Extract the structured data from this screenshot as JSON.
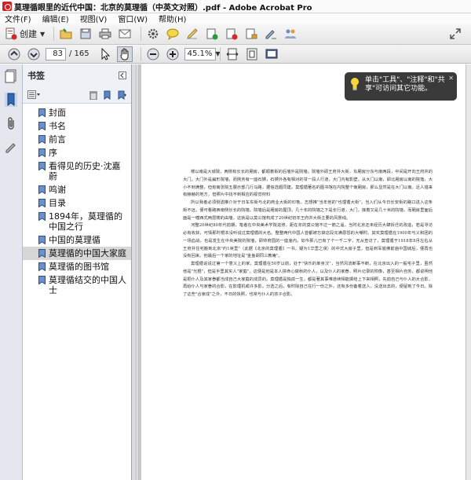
{
  "window": {
    "title": "莫理循眼里的近代中国：北京的莫理循（中英文对照）.pdf - Adobe Acrobat Pro"
  },
  "menu": [
    "文件(F)",
    "编辑(E)",
    "视图(V)",
    "窗口(W)",
    "帮助(H)"
  ],
  "toolbar": {
    "create_label": "创建"
  },
  "nav": {
    "page_current": "83",
    "page_total": "/ 165",
    "zoom": "45.1%",
    "tabs": [
      "工具",
      "注释",
      "共享"
    ]
  },
  "bookmarks": {
    "header": "书签",
    "items": [
      {
        "label": "封面",
        "selected": false
      },
      {
        "label": "书名",
        "selected": false
      },
      {
        "label": "前言",
        "selected": false
      },
      {
        "label": "序",
        "selected": false
      },
      {
        "label": "看得见的历史·沈嘉蔚",
        "selected": false
      },
      {
        "label": "鸣谢",
        "selected": false
      },
      {
        "label": "目录",
        "selected": false
      },
      {
        "label": "1894年，莫理循的中国之行",
        "selected": false
      },
      {
        "label": "中国的莫理循",
        "selected": false
      },
      {
        "label": "莫理循的中国大家庭",
        "selected": true
      },
      {
        "label": "莫理循的图书馆",
        "selected": false
      },
      {
        "label": "莫理循结交的中国人士",
        "selected": false
      }
    ]
  },
  "tooltip": {
    "text": "单击\"工具\"、\"注释\"和\"共享\"可访问其它功能。"
  },
  "document": {
    "paragraphs": [
      "楼以南是大城院，两侧有长长的厢房，都顺着街的后墙外是院墙。院墙外即王府井大街，东厢房分东与南两段，中间是开向王府井的大门。大门外是扁形院墙，而侧务有一座石狮，石狮外各有相对的甘一段人行道，大门内有影壁，从大门以南，即北厢房以南的院落，大小不到满整，但有南张院五展示部几行马路，据信选题同建。莫理循著名的图书馆在内院整个南厢房，那么显然是在大门以南。近人措来有赫赫的地方，但照片中找不到相应的视觉材料",
      "所以我者必须侧滤推介对于日车东街与北的商业大街的印象。志想推\"当年他的\"也理循大街\"。当入们从今日长安街的路口进入这条街不远，便可看路西南侧长长的院墙，院墙后是厢房的屋顶，几十年的院墙之下是长行道，大门，接着又是几十米的院墙，而厢房里面后面是一幢西式两层楼的由墙，这就是以莫公馆构成了20世纪初年王府井大街主要的风景线。",
      "河整20世纪80年代前期，笔者在中央美术学院进修，距在年的莫公馆不过一箭之遥，当时北京还未经历大肆拆迁的改造，若是寻访必有收获，可情那时根本没听说过莫理循的大名。整整两代中国人曾都被忘掉这段充满恩怨的大嘲时。其实莫理循在1900年与义和团的一场血战，也是发生在中央美院的院墙，即帅府园的一座庙内。如今那儿已有了个一千二字，无从查访了，莫理循于1918年8月左右从王府井住宅搬到北京\"约1英里\"（此据《北京的莫理循》一书，疑为1华里之误）的中式大房子里，但是到军底佛前庙中国城后，便再也没有回来。他最后一个家的地址是\"金鱼胡同三教庵\"。",
      "莫理循说说过第一个意义上的家，莫理循在50岁以前，处于\"快乐的单身汉\"，当然风流断事不断，在北京出入的一般宅子里，虽然他是\"光棍\"，但是手里其实人\"家庭\"，这便是他是本人拼命心做秋的仆人，以及仆人的家眷，照片记录的附像，甚至相片自务，都说明他是把仆人及其家眷都当成自己大家庭的成员的。莫理循是独孤一生，都是著其事难道续相能掷结上下来相照，先前自己与仆人的大合影，再给仆人与家眷的合影，在影理机或许多影。分选之后，有时除自己在行一份之外，还有多份备着送人，没送出去的，便留到了今日。除了这些\"合家成\"之外，不日的快照，也常与仆人的孩子合影。"
    ]
  }
}
